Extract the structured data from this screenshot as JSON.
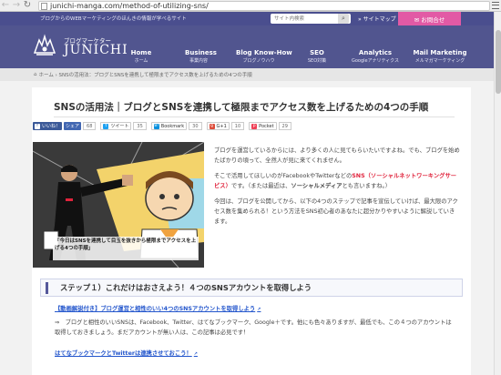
{
  "browser": {
    "url": "junichi-manga.com/method-of-utilizing-sns/"
  },
  "header": {
    "tagline": "ブログからのWEBマーケティングのほんきの情報が学べるサイト",
    "search_placeholder": "サイト内検索",
    "search_icon": "magnifier-icon",
    "sitemap_label": "» サイトマップ",
    "contact_label": "✉ お問合せ",
    "contact_color": "#e25aa5",
    "header_color": "#51558f",
    "logo_sub": "ブログマーケター",
    "logo_main": "JUNICHI"
  },
  "nav": [
    {
      "title": "Home",
      "sub": "ホーム"
    },
    {
      "title": "Business",
      "sub": "事業内容"
    },
    {
      "title": "Blog Know-How",
      "sub": "ブログノウハウ"
    },
    {
      "title": "SEO",
      "sub": "SEO対策"
    },
    {
      "title": "Analytics",
      "sub": "Googleアナリティクス"
    },
    {
      "title": "Mail Marketing",
      "sub": "メルマガマーケティング"
    }
  ],
  "breadcrumb": "ホーム › SNSの活用法：ブログとSNSを連携して極限までアクセス数を上げるための4つの手順",
  "article": {
    "title": "SNSの活用法｜ブログとSNSを連携して極限までアクセス数を上げるための4つの手順",
    "share": {
      "fb_like": "いいね！",
      "fb_share": "シェア",
      "fb_count": "68",
      "tweet": "ツイート",
      "tweet_count": "35",
      "hatena": "Bookmark",
      "hatena_count": "30",
      "gplus": "G+1",
      "gplus_count": "10",
      "pocket": "Pocket",
      "pocket_count": "29"
    },
    "hero_caption": "「今日はSNSを連携して目玉を抜きから極限までアクセスを上げる4つの手順」",
    "para1": "ブログを運営しているからには、より多くの人に見てもらいたいですよね。でも、ブログを始めたばかりの頃って、全然人が見に来てくれません。",
    "para2_a": "そこで活用してほしいのがFacebookやTwitterなどの",
    "para2_red": "SNS（ソーシャルネットワーキングサービス）",
    "para2_b": "です。（または最近は、",
    "para2_bold": "ソーシャルメディア",
    "para2_c": "とも言いますね。）",
    "para3": "今回は、ブログを公開してから、以下の4つのステップで記事を宣伝していけば、最大限のアクセス数を集められる！という方法をSNS初心者のあなたに超分かりやすいように解説していきます。",
    "step1_heading": "ステップ１）これだけはおさえよう！４つのSNSアカウントを取得しよう",
    "link1": "【動画解説付き】ブログ運営と相性のいい4つのSNSアカウントを取得しよう",
    "para4": "ブログと相性のいいSNSは、Facebook、Twitter、はてなブックマーク、Google＋です。他にも色々ありますが、最低でも、この４つのアカウントは取得しておきましょう。まだアカウントが無い人は、この記事は必見です！",
    "link2": "はてなブックマークとTwitterは連携させておこう！"
  }
}
